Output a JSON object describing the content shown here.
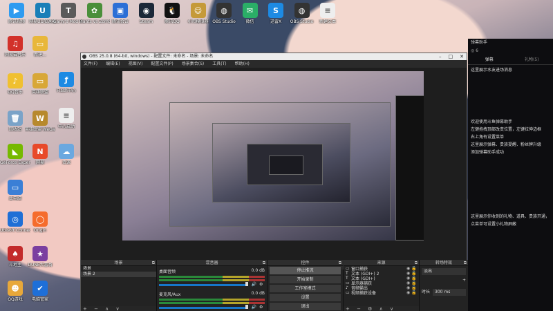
{
  "desktop": {
    "top_icons": [
      {
        "label": "腾讯视频",
        "icon": "tencent-video-icon",
        "color": "#2f9bf0",
        "glyph": "▶"
      },
      {
        "label": "网易UU加速器",
        "icon": "uu-accelerator-icon",
        "color": "#1a7fb8",
        "glyph": "U"
      },
      {
        "label": "Garry's Mod 9 ...",
        "icon": "garrys-mod-icon",
        "color": "#5a5a5a",
        "glyph": "T"
      },
      {
        "label": "Plants vs Zombies GO...",
        "icon": "pvz-icon",
        "color": "#4a8f3a",
        "glyph": "✿"
      },
      {
        "label": "腾讯会议",
        "icon": "tencent-meeting-icon",
        "color": "#2c6fd6",
        "glyph": "▣"
      },
      {
        "label": "Steam",
        "icon": "steam-icon",
        "color": "#1b2838",
        "glyph": "◉"
      },
      {
        "label": "腾讯QQ",
        "icon": "qq-icon",
        "color": "#111",
        "glyph": "🐧"
      },
      {
        "label": "小鸡模拟器",
        "icon": "emulator-icon",
        "color": "#c59a3a",
        "glyph": "☺"
      },
      {
        "label": "OBS Studio",
        "icon": "obs-icon",
        "color": "#333",
        "glyph": "◍"
      },
      {
        "label": "微信",
        "icon": "wechat-icon",
        "color": "#2aae67",
        "glyph": "✉"
      },
      {
        "label": "迅雷X",
        "icon": "thunder-icon",
        "color": "#1d8ae3",
        "glyph": "S"
      },
      {
        "label": "OBS Studio",
        "icon": "obs-icon",
        "color": "#333",
        "glyph": "◍"
      },
      {
        "label": "新建文本",
        "icon": "text-file-icon",
        "color": "#eee",
        "glyph": "≡"
      }
    ],
    "left_icons": [
      {
        "label": "网易云音乐",
        "icon": "netease-music-icon",
        "color": "#d2312a",
        "glyph": "♫"
      },
      {
        "label": "新建...",
        "icon": "folder-icon",
        "color": "#e8b73a",
        "glyph": "▭"
      },
      {
        "label": "QQ音乐",
        "icon": "qq-music-icon",
        "color": "#f0c030",
        "glyph": "♪"
      },
      {
        "label": "英雄联盟",
        "icon": "lol-icon",
        "color": "#d8a737",
        "glyph": "▭"
      },
      {
        "label": "回收站",
        "icon": "recycle-bin-icon",
        "color": "#7aa3c8",
        "glyph": "🗑"
      },
      {
        "label": "英雄联盟 WeGame版",
        "icon": "wegame-icon",
        "color": "#b7892d",
        "glyph": "W"
      },
      {
        "label": "GeForce Experience",
        "icon": "geforce-icon",
        "color": "#76b900",
        "glyph": "◣"
      },
      {
        "label": "网易",
        "icon": "netease-icon",
        "color": "#e84a2a",
        "glyph": "N"
      },
      {
        "label": "此电脑",
        "icon": "this-pc-icon",
        "color": "#3a7fd6",
        "glyph": "▭"
      },
      {
        "label": "Ubisoft Connect",
        "icon": "ubisoft-icon",
        "color": "#1f6fd6",
        "glyph": "◎"
      },
      {
        "label": "Origin",
        "icon": "origin-icon",
        "color": "#f56c2d",
        "glyph": "◯"
      },
      {
        "label": "斗地主",
        "icon": "game-icon",
        "color": "#c32b2b",
        "glyph": "♠"
      },
      {
        "label": "DUNE大富翁",
        "icon": "game2-icon",
        "color": "#7b3fa0",
        "glyph": "★"
      },
      {
        "label": "QQ游戏",
        "icon": "qq-game-icon",
        "color": "#e8a83a",
        "glyph": "☻"
      },
      {
        "label": "电脑管家",
        "icon": "pc-manager-icon",
        "color": "#1e6fd8",
        "glyph": "✔"
      },
      {
        "label": "Flash中心",
        "icon": "flash-icon",
        "color": "#1d8ae3",
        "glyph": "ƒ"
      },
      {
        "label": "中心启动",
        "icon": "doc-icon",
        "color": "#eee",
        "glyph": "≡"
      },
      {
        "label": "资源",
        "icon": "cloud-icon",
        "color": "#6aa8e0",
        "glyph": "☁"
      }
    ]
  },
  "obs": {
    "title": "OBS 25.0.8 (64-bit, windows) - 配置文件: 未命名 - 场景: 未命名",
    "menu": [
      "文件(F)",
      "编辑(E)",
      "视图(V)",
      "配置文件(P)",
      "场景集合(S)",
      "工具(T)",
      "帮助(H)"
    ],
    "docks": {
      "scenes": {
        "title": "场景",
        "items": [
          "场景",
          "场景 2"
        ]
      },
      "mixer": {
        "title": "混音器",
        "channels": [
          {
            "name": "桌面音频",
            "db": "0.0 dB"
          },
          {
            "name": "麦克风/Aux",
            "db": "0.0 dB"
          }
        ]
      },
      "controls": {
        "title": "控件",
        "buttons": [
          "停止推流",
          "开始录制",
          "工作室模式",
          "设置",
          "退出"
        ]
      },
      "sources": {
        "title": "来源",
        "items": [
          {
            "icon": "▭",
            "name": "窗口捕获"
          },
          {
            "icon": "T",
            "name": "文本 (GDI+) 2"
          },
          {
            "icon": "T",
            "name": "文本 (GDI+)"
          },
          {
            "icon": "▭",
            "name": "显示器捕获"
          },
          {
            "icon": "♪",
            "name": "音频输出"
          },
          {
            "icon": "▭",
            "name": "视频捕获设备"
          }
        ]
      },
      "transitions": {
        "title": "转场特效",
        "type": "淡出",
        "duration_label": "时长",
        "duration": "300 ms"
      }
    }
  },
  "danmu": {
    "title": "弹幕助手",
    "sub": "◎ 6",
    "tabs": [
      {
        "label": "弹幕",
        "on": true
      },
      {
        "label": "礼物(5)",
        "on": false
      }
    ],
    "line1": "这里展示水友进场消息",
    "welcome": [
      "欢迎使用斗鱼弹幕助手",
      "左键拖拽顶部改变位置，左键拉伸边框",
      "右上角有设置菜单",
      "这里展示弹幕、贵族提醒、粉丝牌升级",
      "添加弹幕助手成功"
    ],
    "gift_note": "这里展示你收到的礼物、道具、贵族开通，点菜单可设置小礼物屏蔽"
  }
}
